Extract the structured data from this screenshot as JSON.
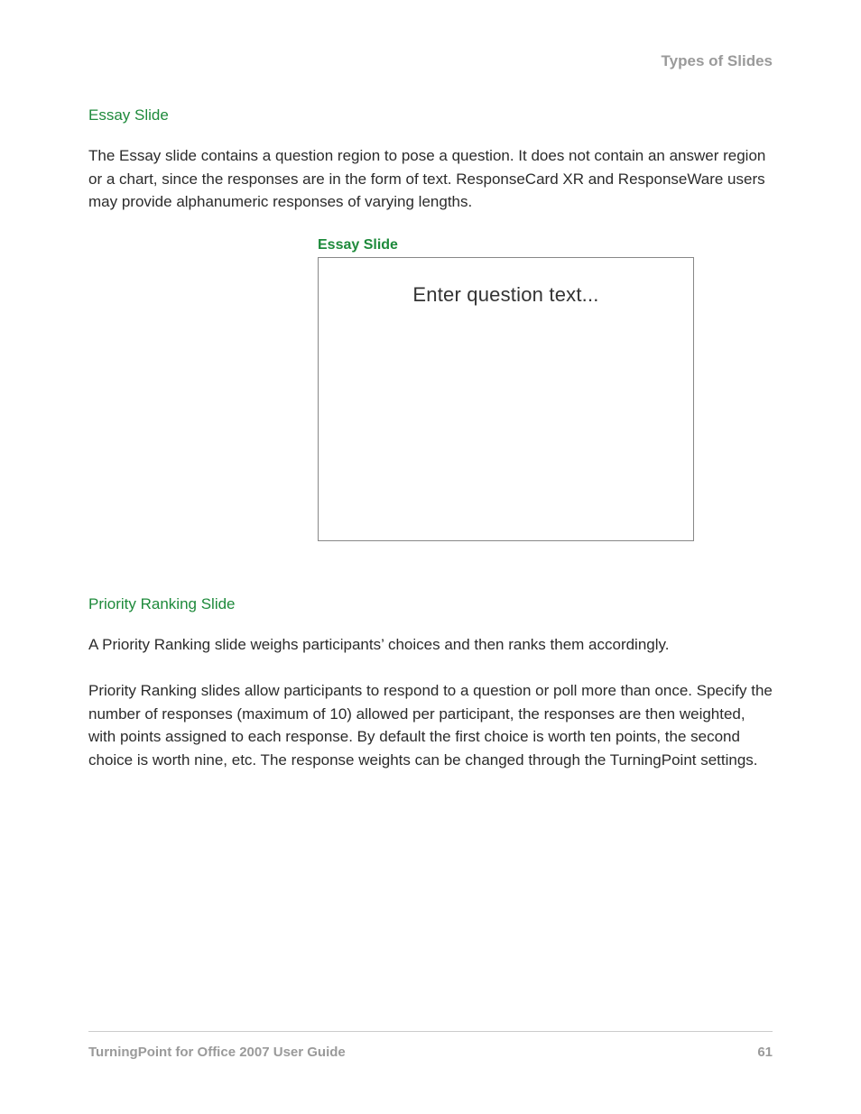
{
  "header": {
    "section_title": "Types of Slides"
  },
  "sections": {
    "essay": {
      "heading": "Essay Slide",
      "paragraph": "The Essay slide contains a question region to pose a question. It does not contain an answer region or a chart, since the responses are in the form of text. ResponseCard XR and ResponseWare users may provide alphanumeric responses of varying lengths.",
      "figure_caption": "Essay Slide",
      "slide_placeholder": "Enter question text..."
    },
    "priority": {
      "heading": "Priority Ranking Slide",
      "paragraph1": "A Priority Ranking slide weighs participants’ choices and then ranks them accordingly.",
      "paragraph2": "Priority Ranking slides allow participants to respond to a question or poll more than once. Specify the number of responses (maximum of 10) allowed per participant, the responses are then weighted, with points assigned to each response. By default the first choice is worth ten points, the second choice is worth nine, etc. The response weights can be changed through the TurningPoint settings."
    }
  },
  "footer": {
    "doc_title": "TurningPoint for Office 2007 User Guide",
    "page_number": "61"
  }
}
